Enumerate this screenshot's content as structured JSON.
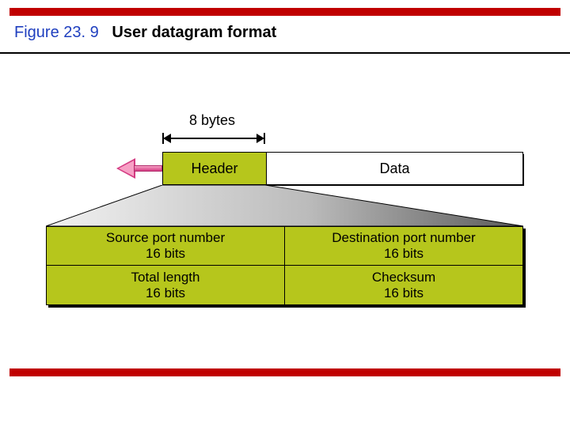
{
  "figure": {
    "number": "Figure 23. 9",
    "caption": "User datagram format"
  },
  "diagram": {
    "bytes_label": "8 bytes",
    "header_label": "Header",
    "data_label": "Data",
    "fields": [
      {
        "name": "Source port number",
        "bits": "16 bits"
      },
      {
        "name": "Destination port number",
        "bits": "16 bits"
      },
      {
        "name": "Total length",
        "bits": "16 bits"
      },
      {
        "name": "Checksum",
        "bits": "16 bits"
      }
    ]
  },
  "colors": {
    "accent_red": "#c00000",
    "field_green": "#b6c61c",
    "figure_blue": "#1f3fbf",
    "arrow_pink": "#d43b82"
  }
}
